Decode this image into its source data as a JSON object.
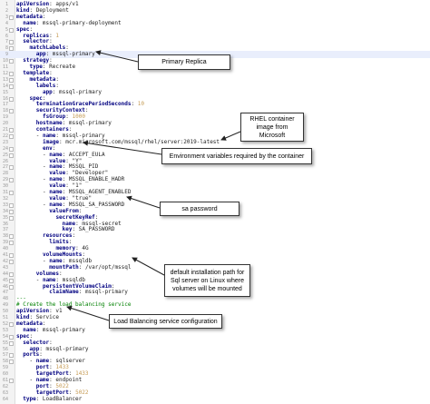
{
  "lines": [
    {
      "n": "1",
      "fold": false,
      "indent": 0,
      "key": "apiVersion",
      "sep": ": ",
      "val": "apps/v1",
      "type": "v"
    },
    {
      "n": "2",
      "fold": false,
      "indent": 0,
      "key": "kind",
      "sep": ": ",
      "val": "Deployment",
      "type": "v"
    },
    {
      "n": "3",
      "fold": true,
      "indent": 0,
      "key": "metadata",
      "sep": ":",
      "val": "",
      "type": "v"
    },
    {
      "n": "4",
      "fold": false,
      "indent": 2,
      "key": "name",
      "sep": ": ",
      "val": "mssql-primary-deployment",
      "type": "v"
    },
    {
      "n": "5",
      "fold": true,
      "indent": 0,
      "key": "spec",
      "sep": ":",
      "val": "",
      "type": "v"
    },
    {
      "n": "6",
      "fold": false,
      "indent": 2,
      "key": "replicas",
      "sep": ": ",
      "val": "1",
      "type": "num"
    },
    {
      "n": "7",
      "fold": true,
      "indent": 2,
      "key": "selector",
      "sep": ":",
      "val": "",
      "type": "v"
    },
    {
      "n": "8",
      "fold": true,
      "indent": 4,
      "key": "matchLabels",
      "sep": ":",
      "val": "",
      "type": "v"
    },
    {
      "n": "9",
      "fold": false,
      "indent": 6,
      "key": "app",
      "sep": ": ",
      "val": "mssql-primary",
      "type": "v",
      "hl": true
    },
    {
      "n": "10",
      "fold": true,
      "indent": 2,
      "key": "strategy",
      "sep": ":",
      "val": "",
      "type": "v"
    },
    {
      "n": "11",
      "fold": false,
      "indent": 4,
      "key": "type",
      "sep": ": ",
      "val": "Recreate",
      "type": "v"
    },
    {
      "n": "12",
      "fold": true,
      "indent": 2,
      "key": "template",
      "sep": ":",
      "val": "",
      "type": "v"
    },
    {
      "n": "13",
      "fold": true,
      "indent": 4,
      "key": "metadata",
      "sep": ":",
      "val": "",
      "type": "v"
    },
    {
      "n": "14",
      "fold": true,
      "indent": 6,
      "key": "labels",
      "sep": ":",
      "val": "",
      "type": "v"
    },
    {
      "n": "15",
      "fold": false,
      "indent": 8,
      "key": "app",
      "sep": ": ",
      "val": "mssql-primary",
      "type": "v"
    },
    {
      "n": "16",
      "fold": true,
      "indent": 4,
      "key": "spec",
      "sep": ":",
      "val": "",
      "type": "v"
    },
    {
      "n": "17",
      "fold": false,
      "indent": 6,
      "key": "terminationGracePeriodSeconds",
      "sep": ": ",
      "val": "10",
      "type": "num"
    },
    {
      "n": "18",
      "fold": true,
      "indent": 6,
      "key": "securityContext",
      "sep": ":",
      "val": "",
      "type": "v"
    },
    {
      "n": "19",
      "fold": false,
      "indent": 8,
      "key": "fsGroup",
      "sep": ": ",
      "val": "1000",
      "type": "num"
    },
    {
      "n": "20",
      "fold": false,
      "indent": 6,
      "key": "hostname",
      "sep": ": ",
      "val": "mssql-primary",
      "type": "v"
    },
    {
      "n": "21",
      "fold": true,
      "indent": 6,
      "key": "containers",
      "sep": ":",
      "val": "",
      "type": "v"
    },
    {
      "n": "22",
      "fold": true,
      "indent": 6,
      "pre": "- ",
      "key": "name",
      "sep": ": ",
      "val": "mssql-primary",
      "type": "v"
    },
    {
      "n": "23",
      "fold": false,
      "indent": 8,
      "key": "image",
      "sep": ": ",
      "val": "mcr.microsoft.com/mssql/rhel/server:2019-latest",
      "type": "v"
    },
    {
      "n": "24",
      "fold": true,
      "indent": 8,
      "key": "env",
      "sep": ":",
      "val": "",
      "type": "v"
    },
    {
      "n": "25",
      "fold": true,
      "indent": 8,
      "pre": "- ",
      "key": "name",
      "sep": ": ",
      "val": "ACCEPT_EULA",
      "type": "v"
    },
    {
      "n": "26",
      "fold": false,
      "indent": 10,
      "key": "value",
      "sep": ": ",
      "val": "\"Y\"",
      "type": "v"
    },
    {
      "n": "27",
      "fold": true,
      "indent": 8,
      "pre": "- ",
      "key": "name",
      "sep": ": ",
      "val": "MSSQL_PID",
      "type": "v"
    },
    {
      "n": "28",
      "fold": false,
      "indent": 10,
      "key": "value",
      "sep": ": ",
      "val": "\"Developer\"",
      "type": "v"
    },
    {
      "n": "29",
      "fold": true,
      "indent": 8,
      "pre": "- ",
      "key": "name",
      "sep": ": ",
      "val": "MSSQL_ENABLE_HADR",
      "type": "v"
    },
    {
      "n": "30",
      "fold": false,
      "indent": 10,
      "key": "value",
      "sep": ": ",
      "val": "\"1\"",
      "type": "v"
    },
    {
      "n": "31",
      "fold": true,
      "indent": 8,
      "pre": "- ",
      "key": "name",
      "sep": ": ",
      "val": "MSSQL_AGENT_ENABLED",
      "type": "v"
    },
    {
      "n": "32",
      "fold": false,
      "indent": 10,
      "key": "value",
      "sep": ": ",
      "val": "\"true\"",
      "type": "v"
    },
    {
      "n": "33",
      "fold": true,
      "indent": 8,
      "pre": "- ",
      "key": "name",
      "sep": ": ",
      "val": "MSSQL_SA_PASSWORD",
      "type": "v"
    },
    {
      "n": "34",
      "fold": true,
      "indent": 10,
      "key": "valueFrom",
      "sep": ":",
      "val": "",
      "type": "v"
    },
    {
      "n": "35",
      "fold": true,
      "indent": 12,
      "key": "secretKeyRef",
      "sep": ":",
      "val": "",
      "type": "v"
    },
    {
      "n": "36",
      "fold": false,
      "indent": 14,
      "key": "name",
      "sep": ": ",
      "val": "mssql-secret",
      "type": "v"
    },
    {
      "n": "37",
      "fold": false,
      "indent": 14,
      "key": "key",
      "sep": ": ",
      "val": "SA_PASSWORD",
      "type": "v"
    },
    {
      "n": "38",
      "fold": true,
      "indent": 8,
      "key": "resources",
      "sep": ":",
      "val": "",
      "type": "v"
    },
    {
      "n": "39",
      "fold": true,
      "indent": 10,
      "key": "limits",
      "sep": ":",
      "val": "",
      "type": "v"
    },
    {
      "n": "40",
      "fold": false,
      "indent": 12,
      "key": "memory",
      "sep": ": ",
      "val": "4G",
      "type": "v"
    },
    {
      "n": "41",
      "fold": true,
      "indent": 8,
      "key": "volumeMounts",
      "sep": ":",
      "val": "",
      "type": "v"
    },
    {
      "n": "42",
      "fold": true,
      "indent": 8,
      "pre": "- ",
      "key": "name",
      "sep": ": ",
      "val": "mssqldb",
      "type": "v"
    },
    {
      "n": "43",
      "fold": false,
      "indent": 10,
      "key": "mountPath",
      "sep": ": ",
      "val": "/var/opt/mssql",
      "type": "v"
    },
    {
      "n": "44",
      "fold": true,
      "indent": 6,
      "key": "volumes",
      "sep": ":",
      "val": "",
      "type": "v"
    },
    {
      "n": "45",
      "fold": true,
      "indent": 6,
      "pre": "- ",
      "key": "name",
      "sep": ": ",
      "val": "mssqldb",
      "type": "v"
    },
    {
      "n": "46",
      "fold": true,
      "indent": 8,
      "key": "persistentVolumeClaim",
      "sep": ":",
      "val": "",
      "type": "v"
    },
    {
      "n": "47",
      "fold": false,
      "indent": 10,
      "key": "claimName",
      "sep": ": ",
      "val": "mssql-primary",
      "type": "v"
    },
    {
      "n": "48",
      "fold": false,
      "indent": 0,
      "key": "",
      "sep": "",
      "val": "---",
      "type": "cm"
    },
    {
      "n": "49",
      "fold": false,
      "indent": 0,
      "key": "",
      "sep": "",
      "val": "# Create the load balancing service",
      "type": "cm"
    },
    {
      "n": "50",
      "fold": false,
      "indent": 0,
      "key": "apiVersion",
      "sep": ": ",
      "val": "v1",
      "type": "v"
    },
    {
      "n": "51",
      "fold": false,
      "indent": 0,
      "key": "kind",
      "sep": ": ",
      "val": "Service",
      "type": "v"
    },
    {
      "n": "52",
      "fold": true,
      "indent": 0,
      "key": "metadata",
      "sep": ":",
      "val": "",
      "type": "v"
    },
    {
      "n": "53",
      "fold": false,
      "indent": 2,
      "key": "name",
      "sep": ": ",
      "val": "mssql-primary",
      "type": "v"
    },
    {
      "n": "54",
      "fold": true,
      "indent": 0,
      "key": "spec",
      "sep": ":",
      "val": "",
      "type": "v"
    },
    {
      "n": "55",
      "fold": true,
      "indent": 2,
      "key": "selector",
      "sep": ":",
      "val": "",
      "type": "v"
    },
    {
      "n": "56",
      "fold": false,
      "indent": 4,
      "key": "app",
      "sep": ": ",
      "val": "mssql-primary",
      "type": "v"
    },
    {
      "n": "57",
      "fold": true,
      "indent": 2,
      "key": "ports",
      "sep": ":",
      "val": "",
      "type": "v"
    },
    {
      "n": "58",
      "fold": true,
      "indent": 4,
      "pre": "- ",
      "key": "name",
      "sep": ": ",
      "val": "sqlserver",
      "type": "v"
    },
    {
      "n": "59",
      "fold": false,
      "indent": 6,
      "key": "port",
      "sep": ": ",
      "val": "1433",
      "type": "num"
    },
    {
      "n": "60",
      "fold": false,
      "indent": 6,
      "key": "targetPort",
      "sep": ": ",
      "val": "1433",
      "type": "num"
    },
    {
      "n": "61",
      "fold": true,
      "indent": 4,
      "pre": "- ",
      "key": "name",
      "sep": ": ",
      "val": "endpoint",
      "type": "v"
    },
    {
      "n": "62",
      "fold": false,
      "indent": 6,
      "key": "port",
      "sep": ": ",
      "val": "5022",
      "type": "num"
    },
    {
      "n": "63",
      "fold": false,
      "indent": 6,
      "key": "targetPort",
      "sep": ": ",
      "val": "5022",
      "type": "num"
    },
    {
      "n": "64",
      "fold": false,
      "indent": 2,
      "key": "type",
      "sep": ": ",
      "val": "LoadBalancer",
      "type": "v"
    }
  ],
  "callouts": [
    {
      "id": "primary-replica",
      "text": "Primary Replica"
    },
    {
      "id": "rhel-image",
      "text": "RHEL container image from Microsoft"
    },
    {
      "id": "env-vars",
      "text": "Environment variables required by the container"
    },
    {
      "id": "sa-password",
      "text": "sa password"
    },
    {
      "id": "install-path",
      "text": "default installation path for Sql server on Linux where volumes will be mounted"
    },
    {
      "id": "lb-service",
      "text": "Load Balancing service configuration"
    }
  ]
}
